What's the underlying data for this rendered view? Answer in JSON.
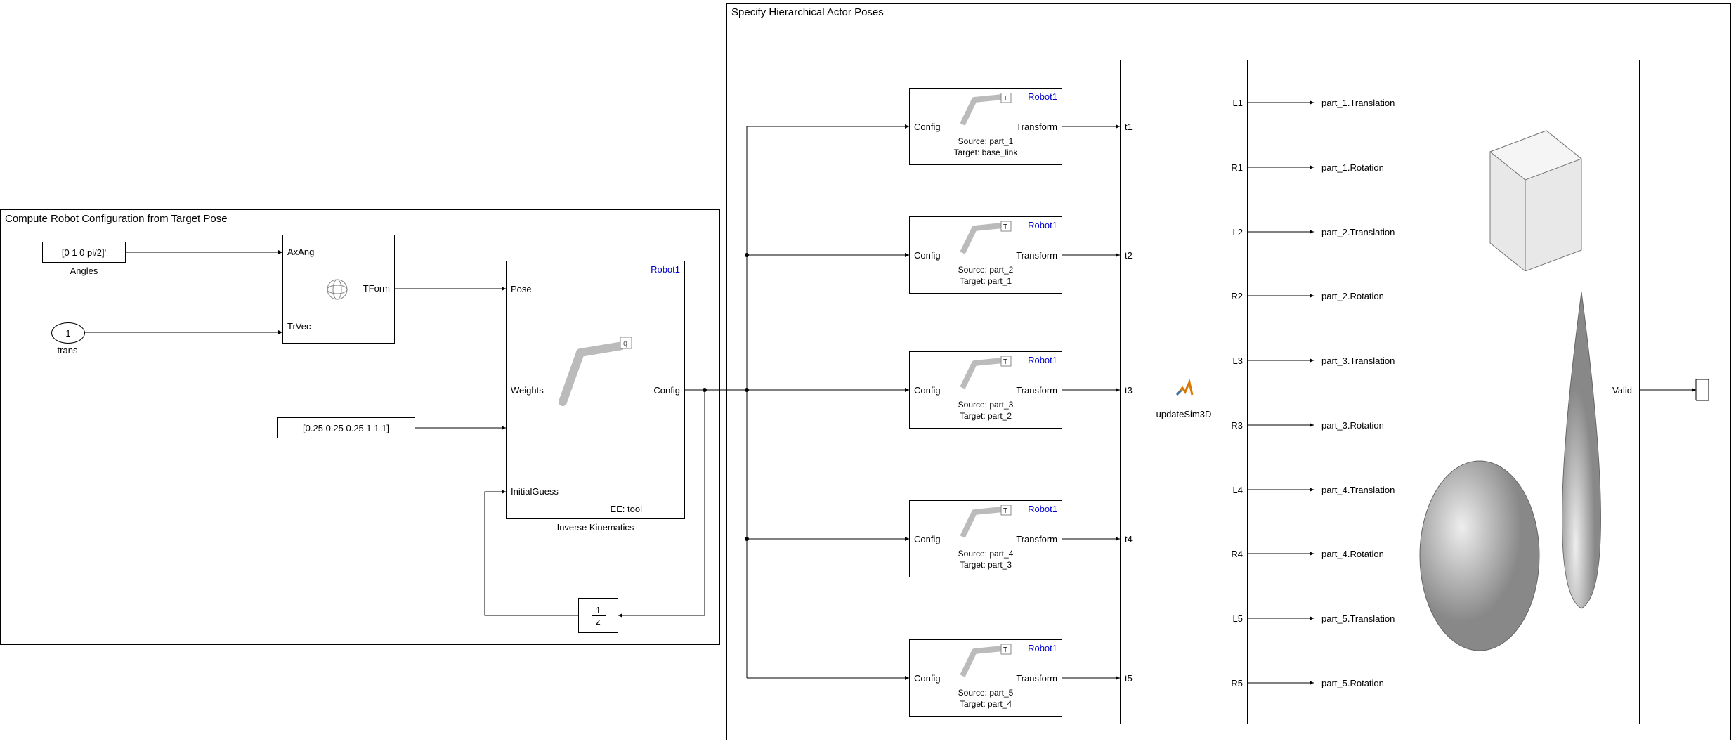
{
  "areas": {
    "compute": {
      "title": "Compute Robot Configuration from Target Pose",
      "bg": "#e7e5fb"
    },
    "specify": {
      "title": "Specify Hierarchical Actor Poses",
      "bg": "#e2f1fb"
    }
  },
  "angles_block": {
    "value": "[0 1 0 pi/2]'",
    "caption": "Angles"
  },
  "trans_inport": {
    "number": "1",
    "caption": "trans"
  },
  "weights_block": {
    "value": "[0.25 0.25 0.25 1 1 1]"
  },
  "tform_block": {
    "in1": "AxAng",
    "in2": "TrVec",
    "out": "TForm"
  },
  "ik_block": {
    "link": "Robot1",
    "in_pose": "Pose",
    "in_weights": "Weights",
    "in_initial": "InitialGuess",
    "out": "Config",
    "footer": "EE: tool",
    "caption": "Inverse Kinematics"
  },
  "delay_block": {
    "numerator": "1",
    "denominator": "z"
  },
  "transform_blocks": [
    {
      "link": "Robot1",
      "in": "Config",
      "out": "Transform",
      "row1": "Source: part_1",
      "row2": "Target: base_link"
    },
    {
      "link": "Robot1",
      "in": "Config",
      "out": "Transform",
      "row1": "Source: part_2",
      "row2": "Target: part_1"
    },
    {
      "link": "Robot1",
      "in": "Config",
      "out": "Transform",
      "row1": "Source: part_3",
      "row2": "Target: part_2"
    },
    {
      "link": "Robot1",
      "in": "Config",
      "out": "Transform",
      "row1": "Source: part_4",
      "row2": "Target: part_3"
    },
    {
      "link": "Robot1",
      "in": "Config",
      "out": "Transform",
      "row1": "Source: part_5",
      "row2": "Target: part_4"
    }
  ],
  "bus_block": {
    "caption": "updateSim3D",
    "in_ports": [
      "t1",
      "t2",
      "t3",
      "t4",
      "t5"
    ],
    "out_ports": [
      "L1",
      "R1",
      "L2",
      "R2",
      "L3",
      "R3",
      "L4",
      "R4",
      "L5",
      "R5"
    ]
  },
  "sim3d_block": {
    "in_ports": [
      "part_1.Translation",
      "part_1.Rotation",
      "part_2.Translation",
      "part_2.Rotation",
      "part_3.Translation",
      "part_3.Rotation",
      "part_4.Translation",
      "part_4.Rotation",
      "part_5.Translation",
      "part_5.Rotation"
    ],
    "out": "Valid"
  }
}
